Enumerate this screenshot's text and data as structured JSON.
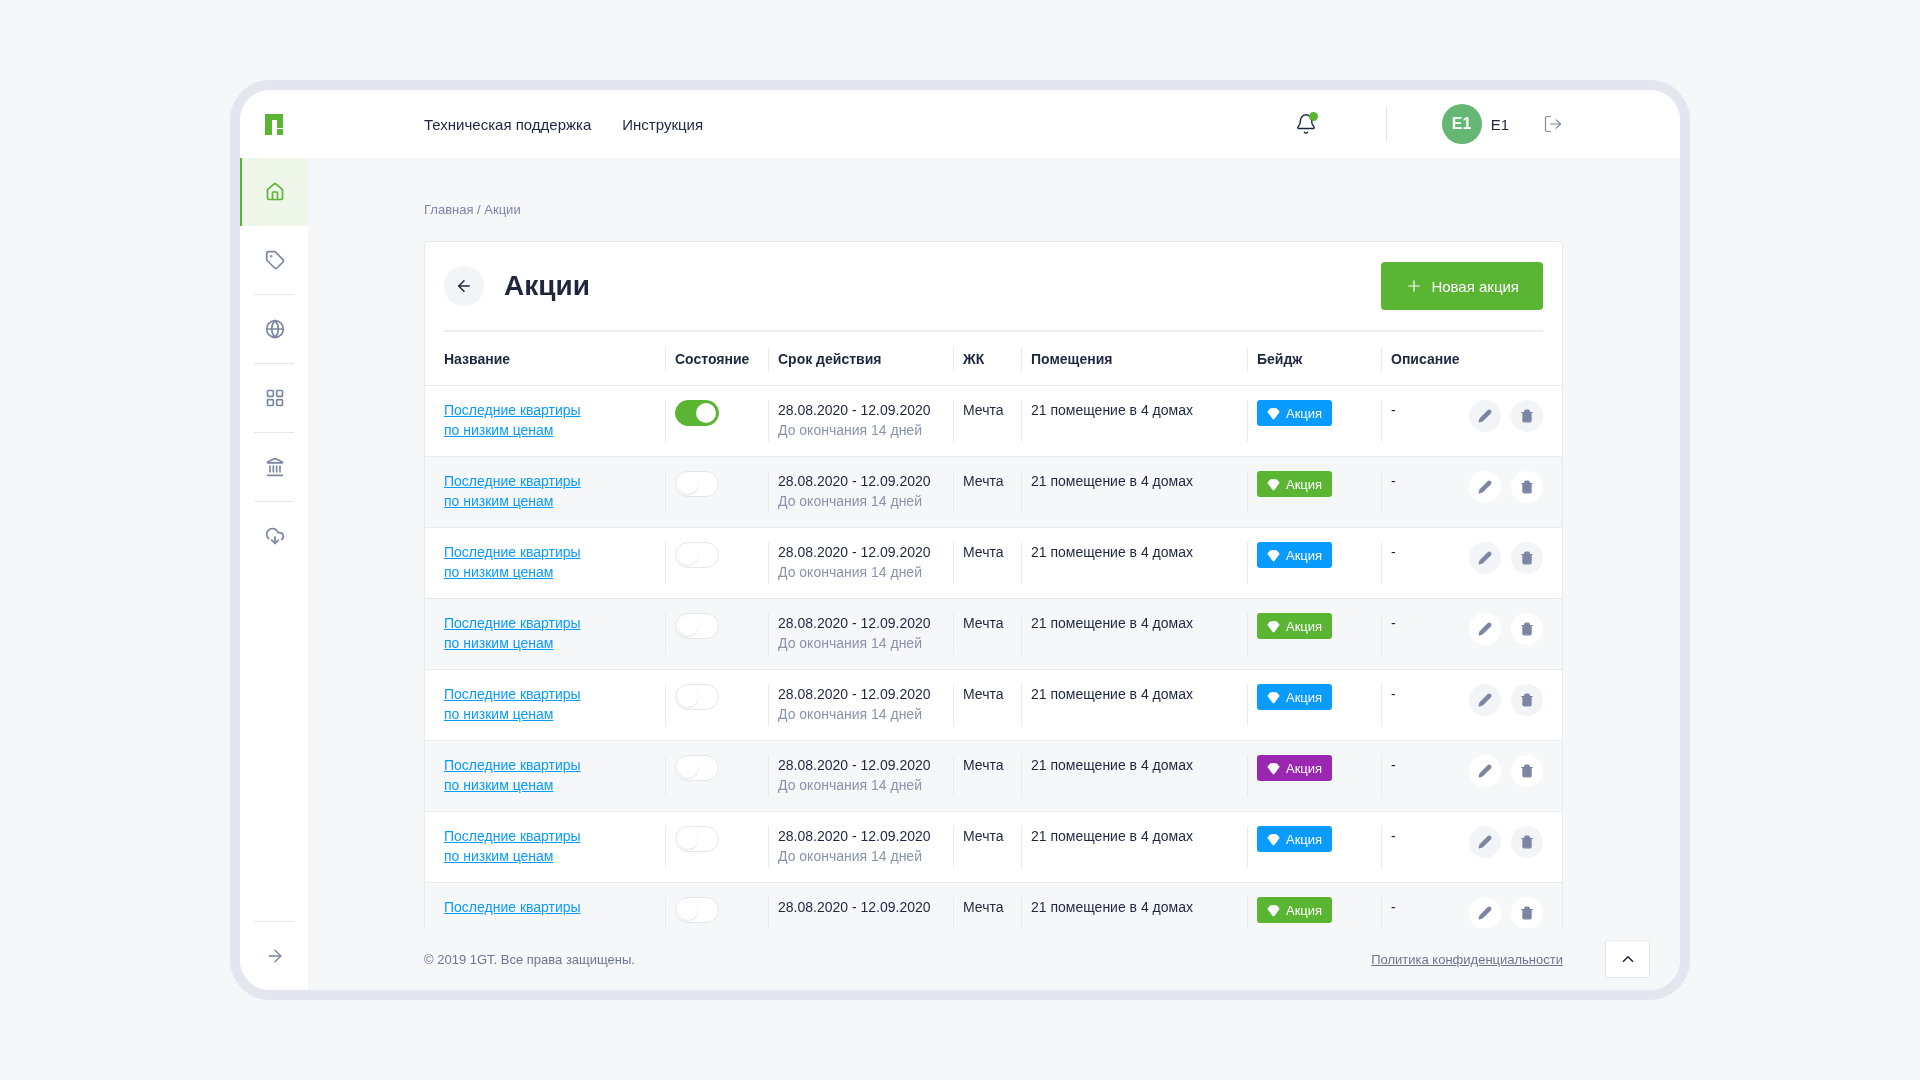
{
  "header": {
    "nav": [
      "Техническая поддержка",
      "Инструкция"
    ],
    "notifications": {
      "unread": true
    },
    "user": {
      "initials": "E1",
      "name": "E1"
    }
  },
  "sidebar": {
    "items": [
      {
        "kind": "home",
        "selected": true
      },
      {
        "kind": "tag",
        "selected": false
      },
      {
        "kind": "globe",
        "selected": false
      },
      {
        "kind": "grid",
        "selected": false
      },
      {
        "kind": "bank",
        "selected": false
      },
      {
        "kind": "cloud",
        "selected": false
      }
    ]
  },
  "breadcrumb": "Главная / Акции",
  "page": {
    "title": "Акции",
    "new_button": "Новая акция"
  },
  "table": {
    "columns": [
      "Название",
      "Состояние",
      "Срок действия",
      "ЖК",
      "Помещения",
      "Бейдж",
      "Описание"
    ],
    "rows": [
      {
        "name": "Последние квартиры\nпо низким ценам",
        "active": true,
        "period": "28.08.2020 - 12.09.2020",
        "period_note": "До окончания 14 дней",
        "complex": "Мечта",
        "premises": "21 помещение в 4 домах",
        "badge": {
          "label": "Акция",
          "color": "#0a9bff"
        },
        "description": "-"
      },
      {
        "name": "Последние квартиры\nпо низким ценам",
        "active": false,
        "period": "28.08.2020 - 12.09.2020",
        "period_note": "До окончания 14 дней",
        "complex": "Мечта",
        "premises": "21 помещение в 4 домах",
        "badge": {
          "label": "Акция",
          "color": "#5ab532"
        },
        "description": "-"
      },
      {
        "name": "Последние квартиры\nпо низким ценам",
        "active": false,
        "period": "28.08.2020 - 12.09.2020",
        "period_note": "До окончания 14 дней",
        "complex": "Мечта",
        "premises": "21 помещение в 4 домах",
        "badge": {
          "label": "Акция",
          "color": "#0a9bff"
        },
        "description": "-"
      },
      {
        "name": "Последние квартиры\nпо низким ценам",
        "active": false,
        "period": "28.08.2020 - 12.09.2020",
        "period_note": "До окончания 14 дней",
        "complex": "Мечта",
        "premises": "21 помещение в 4 домах",
        "badge": {
          "label": "Акция",
          "color": "#5ab532"
        },
        "description": "-"
      },
      {
        "name": "Последние квартиры\nпо низким ценам",
        "active": false,
        "period": "28.08.2020 - 12.09.2020",
        "period_note": "До окончания 14 дней",
        "complex": "Мечта",
        "premises": "21 помещение в 4 домах",
        "badge": {
          "label": "Акция",
          "color": "#0a9bff"
        },
        "description": "-"
      },
      {
        "name": "Последние квартиры\nпо низким ценам",
        "active": false,
        "period": "28.08.2020 - 12.09.2020",
        "period_note": "До окончания 14 дней",
        "complex": "Мечта",
        "premises": "21 помещение в 4 домах",
        "badge": {
          "label": "Акция",
          "color": "#9b27b0"
        },
        "description": "-"
      },
      {
        "name": "Последние квартиры\nпо низким ценам",
        "active": false,
        "period": "28.08.2020 - 12.09.2020",
        "period_note": "До окончания 14 дней",
        "complex": "Мечта",
        "premises": "21 помещение в 4 домах",
        "badge": {
          "label": "Акция",
          "color": "#0a9bff"
        },
        "description": "-"
      },
      {
        "name": "Последние квартиры",
        "active": false,
        "period": "28.08.2020 - 12.09.2020",
        "complex": "Мечта",
        "premises": "21 помещение в 4 домах",
        "badge": {
          "label": "Акция",
          "color": "#5ab532"
        },
        "description": "-"
      }
    ]
  },
  "footer": {
    "copyright": "© 2019 1GT. Все права защищены.",
    "privacy_link": "Политика конфиденциальности"
  }
}
